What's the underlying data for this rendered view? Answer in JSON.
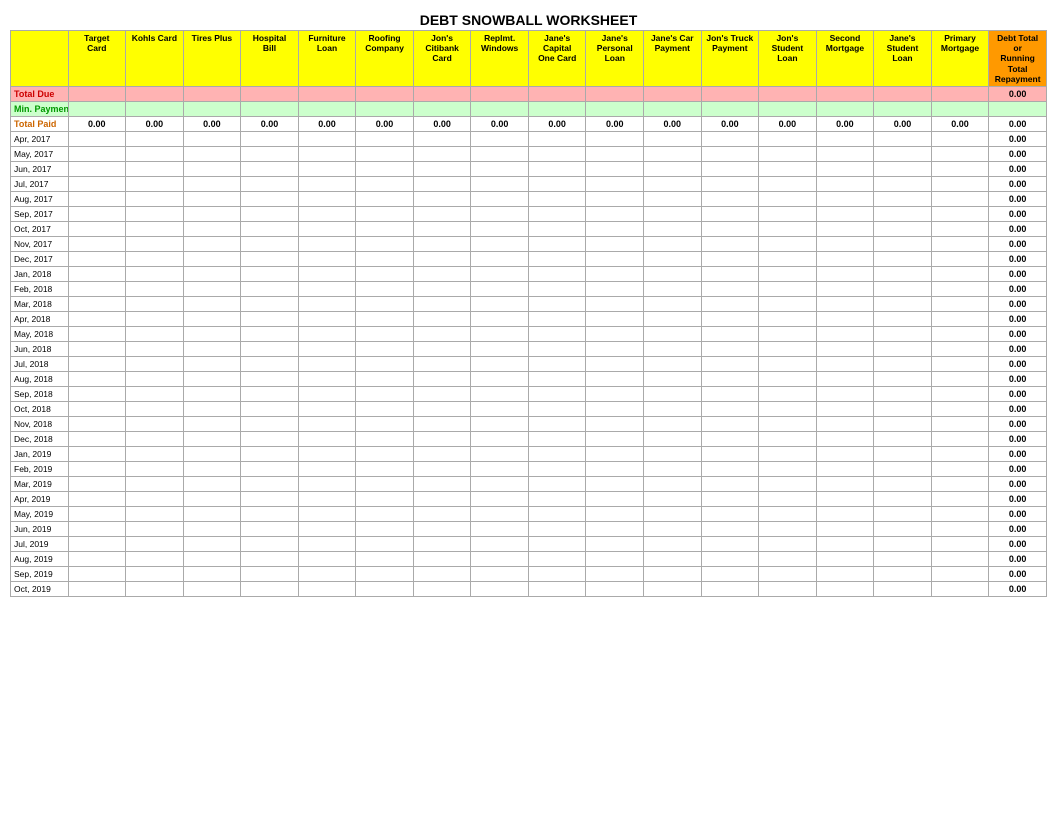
{
  "title": "DEBT SNOWBALL WORKSHEET",
  "columns": [
    {
      "label": "",
      "key": "date"
    },
    {
      "label": "Target\nCard",
      "key": "target_card"
    },
    {
      "label": "Kohls Card",
      "key": "kohls_card"
    },
    {
      "label": "Tires Plus",
      "key": "tires_plus"
    },
    {
      "label": "Hospital\nBill",
      "key": "hospital_bill"
    },
    {
      "label": "Furniture\nLoan",
      "key": "furniture_loan"
    },
    {
      "label": "Roofing\nCompany",
      "key": "roofing_company"
    },
    {
      "label": "Jon's\nCitibank\nCard",
      "key": "jons_citibank"
    },
    {
      "label": "Replmt.\nWindows",
      "key": "replmt_windows"
    },
    {
      "label": "Jane's\nCapital\nOne Card",
      "key": "janes_capital"
    },
    {
      "label": "Jane's\nPersonal\nLoan",
      "key": "janes_personal"
    },
    {
      "label": "Jane's Car\nPayment",
      "key": "janes_car"
    },
    {
      "label": "Jon's Truck\nPayment",
      "key": "jons_truck"
    },
    {
      "label": "Jon's\nStudent\nLoan",
      "key": "jons_student"
    },
    {
      "label": "Second\nMortgage",
      "key": "second_mortgage"
    },
    {
      "label": "Jane's\nStudent\nLoan",
      "key": "janes_student"
    },
    {
      "label": "Primary\nMortgage",
      "key": "primary_mortgage"
    },
    {
      "label": "Debt Total or\nRunning Total\nRepayment",
      "key": "total"
    }
  ],
  "rows": {
    "total_due": {
      "label": "Total Due",
      "value": "0.00"
    },
    "min_payment": {
      "label": "Min. Payment"
    },
    "total_paid": {
      "label": "Total Paid",
      "value": "0.00",
      "zeros": "0.00"
    }
  },
  "dates": [
    "Apr, 2017",
    "May, 2017",
    "Jun, 2017",
    "Jul, 2017",
    "Aug, 2017",
    "Sep, 2017",
    "Oct, 2017",
    "Nov, 2017",
    "Dec, 2017",
    "Jan, 2018",
    "Feb, 2018",
    "Mar, 2018",
    "Apr, 2018",
    "May, 2018",
    "Jun, 2018",
    "Jul, 2018",
    "Aug, 2018",
    "Sep, 2018",
    "Oct, 2018",
    "Nov, 2018",
    "Dec, 2018",
    "Jan, 2019",
    "Feb, 2019",
    "Mar, 2019",
    "Apr, 2019",
    "May, 2019",
    "Jun, 2019",
    "Jul, 2019",
    "Aug, 2019",
    "Sep, 2019",
    "Oct, 2019"
  ],
  "zero": "0.00"
}
